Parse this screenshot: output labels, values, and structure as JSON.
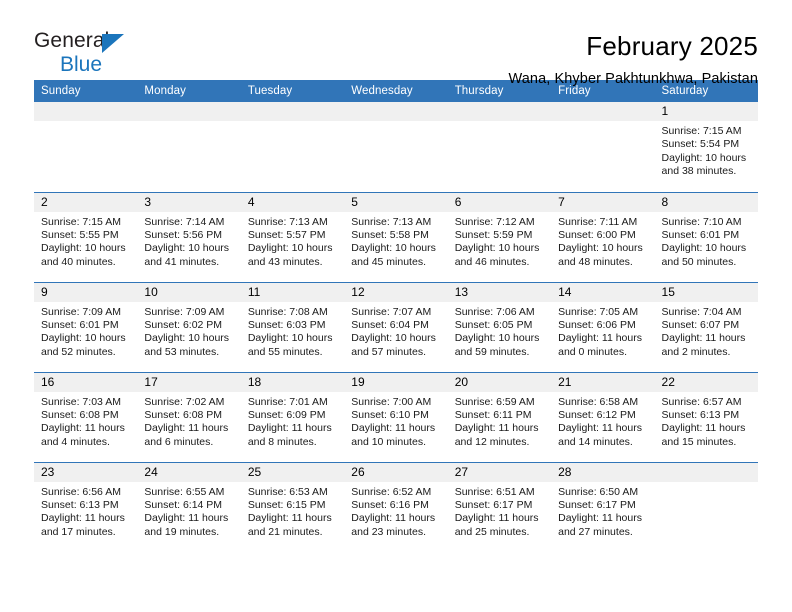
{
  "brand": {
    "name_part1": "General",
    "name_part2": "Blue",
    "triangle_color": "#1b75bc",
    "text_color": "#231f20"
  },
  "header": {
    "title": "February 2025",
    "subtitle": "Wana, Khyber Pakhtunkhwa, Pakistan"
  },
  "theme": {
    "header_blue": "#3175b8",
    "daynum_band": "#f0f0f0",
    "cell_background": "#ffffff",
    "text": "#000000"
  },
  "weekday_headers": [
    "Sunday",
    "Monday",
    "Tuesday",
    "Wednesday",
    "Thursday",
    "Friday",
    "Saturday"
  ],
  "labels": {
    "sunrise_prefix": "Sunrise:",
    "sunset_prefix": "Sunset:",
    "daylight_prefix": "Daylight:"
  },
  "weeks": [
    {
      "days": [
        {
          "num": "",
          "sunrise": "",
          "sunset": "",
          "daylight_line1": "",
          "daylight_line2": "",
          "empty": true
        },
        {
          "num": "",
          "sunrise": "",
          "sunset": "",
          "daylight_line1": "",
          "daylight_line2": "",
          "empty": true
        },
        {
          "num": "",
          "sunrise": "",
          "sunset": "",
          "daylight_line1": "",
          "daylight_line2": "",
          "empty": true
        },
        {
          "num": "",
          "sunrise": "",
          "sunset": "",
          "daylight_line1": "",
          "daylight_line2": "",
          "empty": true
        },
        {
          "num": "",
          "sunrise": "",
          "sunset": "",
          "daylight_line1": "",
          "daylight_line2": "",
          "empty": true
        },
        {
          "num": "",
          "sunrise": "",
          "sunset": "",
          "daylight_line1": "",
          "daylight_line2": "",
          "empty": true
        },
        {
          "num": "1",
          "sunrise": "Sunrise: 7:15 AM",
          "sunset": "Sunset: 5:54 PM",
          "daylight_line1": "Daylight: 10 hours",
          "daylight_line2": "and 38 minutes.",
          "empty": false
        }
      ]
    },
    {
      "days": [
        {
          "num": "2",
          "sunrise": "Sunrise: 7:15 AM",
          "sunset": "Sunset: 5:55 PM",
          "daylight_line1": "Daylight: 10 hours",
          "daylight_line2": "and 40 minutes.",
          "empty": false
        },
        {
          "num": "3",
          "sunrise": "Sunrise: 7:14 AM",
          "sunset": "Sunset: 5:56 PM",
          "daylight_line1": "Daylight: 10 hours",
          "daylight_line2": "and 41 minutes.",
          "empty": false
        },
        {
          "num": "4",
          "sunrise": "Sunrise: 7:13 AM",
          "sunset": "Sunset: 5:57 PM",
          "daylight_line1": "Daylight: 10 hours",
          "daylight_line2": "and 43 minutes.",
          "empty": false
        },
        {
          "num": "5",
          "sunrise": "Sunrise: 7:13 AM",
          "sunset": "Sunset: 5:58 PM",
          "daylight_line1": "Daylight: 10 hours",
          "daylight_line2": "and 45 minutes.",
          "empty": false
        },
        {
          "num": "6",
          "sunrise": "Sunrise: 7:12 AM",
          "sunset": "Sunset: 5:59 PM",
          "daylight_line1": "Daylight: 10 hours",
          "daylight_line2": "and 46 minutes.",
          "empty": false
        },
        {
          "num": "7",
          "sunrise": "Sunrise: 7:11 AM",
          "sunset": "Sunset: 6:00 PM",
          "daylight_line1": "Daylight: 10 hours",
          "daylight_line2": "and 48 minutes.",
          "empty": false
        },
        {
          "num": "8",
          "sunrise": "Sunrise: 7:10 AM",
          "sunset": "Sunset: 6:01 PM",
          "daylight_line1": "Daylight: 10 hours",
          "daylight_line2": "and 50 minutes.",
          "empty": false
        }
      ]
    },
    {
      "days": [
        {
          "num": "9",
          "sunrise": "Sunrise: 7:09 AM",
          "sunset": "Sunset: 6:01 PM",
          "daylight_line1": "Daylight: 10 hours",
          "daylight_line2": "and 52 minutes.",
          "empty": false
        },
        {
          "num": "10",
          "sunrise": "Sunrise: 7:09 AM",
          "sunset": "Sunset: 6:02 PM",
          "daylight_line1": "Daylight: 10 hours",
          "daylight_line2": "and 53 minutes.",
          "empty": false
        },
        {
          "num": "11",
          "sunrise": "Sunrise: 7:08 AM",
          "sunset": "Sunset: 6:03 PM",
          "daylight_line1": "Daylight: 10 hours",
          "daylight_line2": "and 55 minutes.",
          "empty": false
        },
        {
          "num": "12",
          "sunrise": "Sunrise: 7:07 AM",
          "sunset": "Sunset: 6:04 PM",
          "daylight_line1": "Daylight: 10 hours",
          "daylight_line2": "and 57 minutes.",
          "empty": false
        },
        {
          "num": "13",
          "sunrise": "Sunrise: 7:06 AM",
          "sunset": "Sunset: 6:05 PM",
          "daylight_line1": "Daylight: 10 hours",
          "daylight_line2": "and 59 minutes.",
          "empty": false
        },
        {
          "num": "14",
          "sunrise": "Sunrise: 7:05 AM",
          "sunset": "Sunset: 6:06 PM",
          "daylight_line1": "Daylight: 11 hours",
          "daylight_line2": "and 0 minutes.",
          "empty": false
        },
        {
          "num": "15",
          "sunrise": "Sunrise: 7:04 AM",
          "sunset": "Sunset: 6:07 PM",
          "daylight_line1": "Daylight: 11 hours",
          "daylight_line2": "and 2 minutes.",
          "empty": false
        }
      ]
    },
    {
      "days": [
        {
          "num": "16",
          "sunrise": "Sunrise: 7:03 AM",
          "sunset": "Sunset: 6:08 PM",
          "daylight_line1": "Daylight: 11 hours",
          "daylight_line2": "and 4 minutes.",
          "empty": false
        },
        {
          "num": "17",
          "sunrise": "Sunrise: 7:02 AM",
          "sunset": "Sunset: 6:08 PM",
          "daylight_line1": "Daylight: 11 hours",
          "daylight_line2": "and 6 minutes.",
          "empty": false
        },
        {
          "num": "18",
          "sunrise": "Sunrise: 7:01 AM",
          "sunset": "Sunset: 6:09 PM",
          "daylight_line1": "Daylight: 11 hours",
          "daylight_line2": "and 8 minutes.",
          "empty": false
        },
        {
          "num": "19",
          "sunrise": "Sunrise: 7:00 AM",
          "sunset": "Sunset: 6:10 PM",
          "daylight_line1": "Daylight: 11 hours",
          "daylight_line2": "and 10 minutes.",
          "empty": false
        },
        {
          "num": "20",
          "sunrise": "Sunrise: 6:59 AM",
          "sunset": "Sunset: 6:11 PM",
          "daylight_line1": "Daylight: 11 hours",
          "daylight_line2": "and 12 minutes.",
          "empty": false
        },
        {
          "num": "21",
          "sunrise": "Sunrise: 6:58 AM",
          "sunset": "Sunset: 6:12 PM",
          "daylight_line1": "Daylight: 11 hours",
          "daylight_line2": "and 14 minutes.",
          "empty": false
        },
        {
          "num": "22",
          "sunrise": "Sunrise: 6:57 AM",
          "sunset": "Sunset: 6:13 PM",
          "daylight_line1": "Daylight: 11 hours",
          "daylight_line2": "and 15 minutes.",
          "empty": false
        }
      ]
    },
    {
      "days": [
        {
          "num": "23",
          "sunrise": "Sunrise: 6:56 AM",
          "sunset": "Sunset: 6:13 PM",
          "daylight_line1": "Daylight: 11 hours",
          "daylight_line2": "and 17 minutes.",
          "empty": false
        },
        {
          "num": "24",
          "sunrise": "Sunrise: 6:55 AM",
          "sunset": "Sunset: 6:14 PM",
          "daylight_line1": "Daylight: 11 hours",
          "daylight_line2": "and 19 minutes.",
          "empty": false
        },
        {
          "num": "25",
          "sunrise": "Sunrise: 6:53 AM",
          "sunset": "Sunset: 6:15 PM",
          "daylight_line1": "Daylight: 11 hours",
          "daylight_line2": "and 21 minutes.",
          "empty": false
        },
        {
          "num": "26",
          "sunrise": "Sunrise: 6:52 AM",
          "sunset": "Sunset: 6:16 PM",
          "daylight_line1": "Daylight: 11 hours",
          "daylight_line2": "and 23 minutes.",
          "empty": false
        },
        {
          "num": "27",
          "sunrise": "Sunrise: 6:51 AM",
          "sunset": "Sunset: 6:17 PM",
          "daylight_line1": "Daylight: 11 hours",
          "daylight_line2": "and 25 minutes.",
          "empty": false
        },
        {
          "num": "28",
          "sunrise": "Sunrise: 6:50 AM",
          "sunset": "Sunset: 6:17 PM",
          "daylight_line1": "Daylight: 11 hours",
          "daylight_line2": "and 27 minutes.",
          "empty": false
        },
        {
          "num": "",
          "sunrise": "",
          "sunset": "",
          "daylight_line1": "",
          "daylight_line2": "",
          "empty": true
        }
      ]
    }
  ]
}
